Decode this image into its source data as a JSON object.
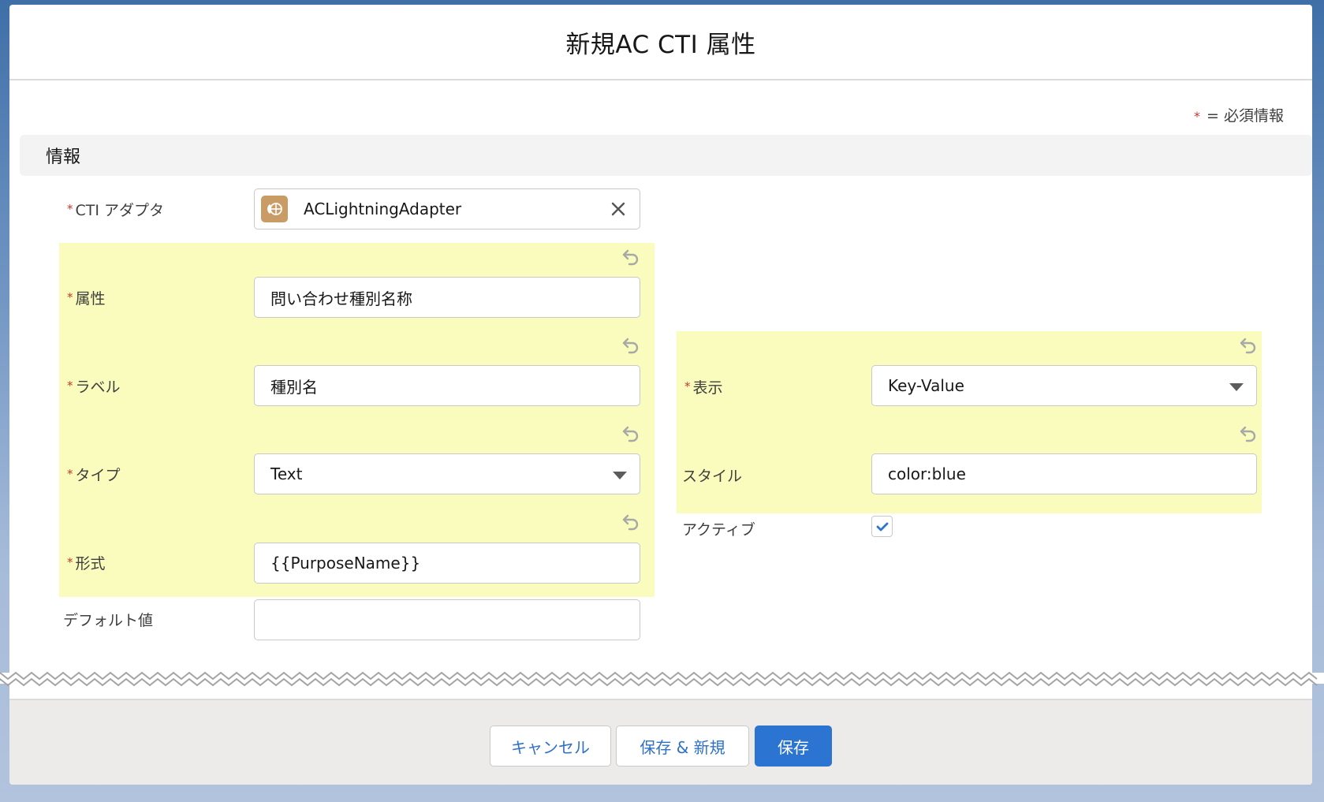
{
  "modal": {
    "title": "新規AC CTI 属性",
    "required_note": "= 必須情報",
    "required_star": "*",
    "section_title": "情報"
  },
  "fields": {
    "adapter": {
      "label": "CTI アダプタ",
      "required": true,
      "value": "ACLightningAdapter",
      "icon": "cti-adapter-icon",
      "icon_color": "#c99c66"
    },
    "attribute": {
      "label": "属性",
      "required": true,
      "value": "問い合わせ種別名称",
      "changed": true
    },
    "label": {
      "label": "ラベル",
      "required": true,
      "value": "種別名",
      "changed": true
    },
    "type": {
      "label": "タイプ",
      "required": true,
      "value": "Text",
      "control": "select",
      "changed": true
    },
    "format": {
      "label": "形式",
      "required": true,
      "value": "{{PurposeName}}",
      "changed": true
    },
    "default_value": {
      "label": "デフォルト値",
      "required": false,
      "value": ""
    },
    "display": {
      "label": "表示",
      "required": true,
      "value": "Key-Value",
      "control": "select",
      "changed": true
    },
    "style": {
      "label": "スタイル",
      "required": false,
      "value": "color:blue",
      "changed": true
    },
    "active": {
      "label": "アクティブ",
      "required": false,
      "checked": true
    }
  },
  "footer": {
    "cancel_label": "キャンセル",
    "save_new_label": "保存 & 新規",
    "save_label": "保存"
  },
  "colors": {
    "changed_highlight": "#f9fcbd",
    "brand": "#2b74d1",
    "required": "#c23934"
  }
}
